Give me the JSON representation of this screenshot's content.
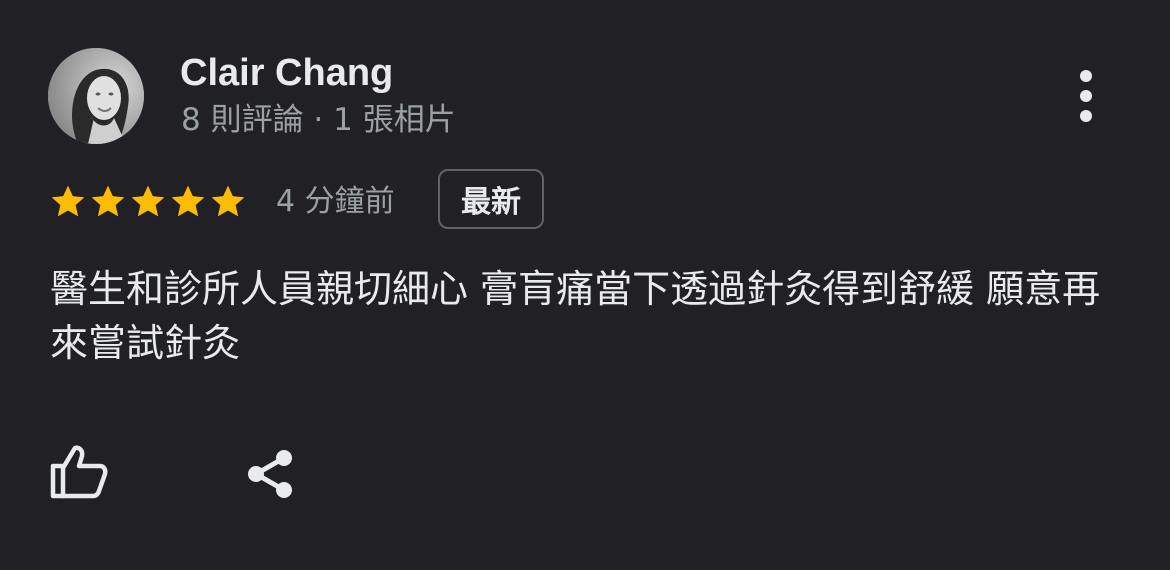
{
  "review": {
    "author_name": "Clair Chang",
    "author_stats": "8 則評論 · 1 張相片",
    "rating": 5,
    "rating_max": 5,
    "time_ago": "4 分鐘前",
    "badge": "最新",
    "text": "醫生和診所人員親切細心 膏肓痛當下透過針灸得到舒緩 願意再來嘗試針灸"
  },
  "icons": {
    "avatar": "profile-photo",
    "more": "more-vert-icon",
    "star": "star-icon",
    "like": "thumb-up-icon",
    "share": "share-icon"
  },
  "colors": {
    "background": "#212125",
    "primary_text": "#e8eaed",
    "secondary_text": "#9aa0a6",
    "star": "#fbbc04",
    "badge_border": "#5f6368"
  }
}
